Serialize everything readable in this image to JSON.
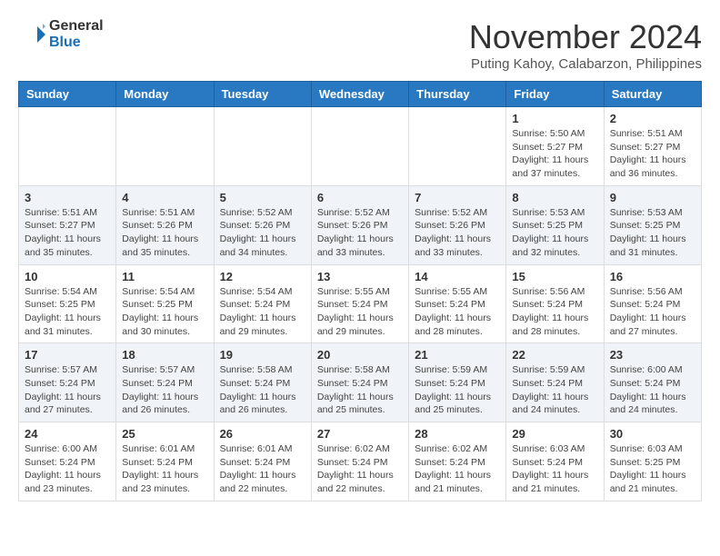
{
  "logo": {
    "general": "General",
    "blue": "Blue"
  },
  "header": {
    "month": "November 2024",
    "location": "Puting Kahoy, Calabarzon, Philippines"
  },
  "weekdays": [
    "Sunday",
    "Monday",
    "Tuesday",
    "Wednesday",
    "Thursday",
    "Friday",
    "Saturday"
  ],
  "weeks": [
    [
      {
        "day": "",
        "info": ""
      },
      {
        "day": "",
        "info": ""
      },
      {
        "day": "",
        "info": ""
      },
      {
        "day": "",
        "info": ""
      },
      {
        "day": "",
        "info": ""
      },
      {
        "day": "1",
        "info": "Sunrise: 5:50 AM\nSunset: 5:27 PM\nDaylight: 11 hours and 37 minutes."
      },
      {
        "day": "2",
        "info": "Sunrise: 5:51 AM\nSunset: 5:27 PM\nDaylight: 11 hours and 36 minutes."
      }
    ],
    [
      {
        "day": "3",
        "info": "Sunrise: 5:51 AM\nSunset: 5:27 PM\nDaylight: 11 hours and 35 minutes."
      },
      {
        "day": "4",
        "info": "Sunrise: 5:51 AM\nSunset: 5:26 PM\nDaylight: 11 hours and 35 minutes."
      },
      {
        "day": "5",
        "info": "Sunrise: 5:52 AM\nSunset: 5:26 PM\nDaylight: 11 hours and 34 minutes."
      },
      {
        "day": "6",
        "info": "Sunrise: 5:52 AM\nSunset: 5:26 PM\nDaylight: 11 hours and 33 minutes."
      },
      {
        "day": "7",
        "info": "Sunrise: 5:52 AM\nSunset: 5:26 PM\nDaylight: 11 hours and 33 minutes."
      },
      {
        "day": "8",
        "info": "Sunrise: 5:53 AM\nSunset: 5:25 PM\nDaylight: 11 hours and 32 minutes."
      },
      {
        "day": "9",
        "info": "Sunrise: 5:53 AM\nSunset: 5:25 PM\nDaylight: 11 hours and 31 minutes."
      }
    ],
    [
      {
        "day": "10",
        "info": "Sunrise: 5:54 AM\nSunset: 5:25 PM\nDaylight: 11 hours and 31 minutes."
      },
      {
        "day": "11",
        "info": "Sunrise: 5:54 AM\nSunset: 5:25 PM\nDaylight: 11 hours and 30 minutes."
      },
      {
        "day": "12",
        "info": "Sunrise: 5:54 AM\nSunset: 5:24 PM\nDaylight: 11 hours and 29 minutes."
      },
      {
        "day": "13",
        "info": "Sunrise: 5:55 AM\nSunset: 5:24 PM\nDaylight: 11 hours and 29 minutes."
      },
      {
        "day": "14",
        "info": "Sunrise: 5:55 AM\nSunset: 5:24 PM\nDaylight: 11 hours and 28 minutes."
      },
      {
        "day": "15",
        "info": "Sunrise: 5:56 AM\nSunset: 5:24 PM\nDaylight: 11 hours and 28 minutes."
      },
      {
        "day": "16",
        "info": "Sunrise: 5:56 AM\nSunset: 5:24 PM\nDaylight: 11 hours and 27 minutes."
      }
    ],
    [
      {
        "day": "17",
        "info": "Sunrise: 5:57 AM\nSunset: 5:24 PM\nDaylight: 11 hours and 27 minutes."
      },
      {
        "day": "18",
        "info": "Sunrise: 5:57 AM\nSunset: 5:24 PM\nDaylight: 11 hours and 26 minutes."
      },
      {
        "day": "19",
        "info": "Sunrise: 5:58 AM\nSunset: 5:24 PM\nDaylight: 11 hours and 26 minutes."
      },
      {
        "day": "20",
        "info": "Sunrise: 5:58 AM\nSunset: 5:24 PM\nDaylight: 11 hours and 25 minutes."
      },
      {
        "day": "21",
        "info": "Sunrise: 5:59 AM\nSunset: 5:24 PM\nDaylight: 11 hours and 25 minutes."
      },
      {
        "day": "22",
        "info": "Sunrise: 5:59 AM\nSunset: 5:24 PM\nDaylight: 11 hours and 24 minutes."
      },
      {
        "day": "23",
        "info": "Sunrise: 6:00 AM\nSunset: 5:24 PM\nDaylight: 11 hours and 24 minutes."
      }
    ],
    [
      {
        "day": "24",
        "info": "Sunrise: 6:00 AM\nSunset: 5:24 PM\nDaylight: 11 hours and 23 minutes."
      },
      {
        "day": "25",
        "info": "Sunrise: 6:01 AM\nSunset: 5:24 PM\nDaylight: 11 hours and 23 minutes."
      },
      {
        "day": "26",
        "info": "Sunrise: 6:01 AM\nSunset: 5:24 PM\nDaylight: 11 hours and 22 minutes."
      },
      {
        "day": "27",
        "info": "Sunrise: 6:02 AM\nSunset: 5:24 PM\nDaylight: 11 hours and 22 minutes."
      },
      {
        "day": "28",
        "info": "Sunrise: 6:02 AM\nSunset: 5:24 PM\nDaylight: 11 hours and 21 minutes."
      },
      {
        "day": "29",
        "info": "Sunrise: 6:03 AM\nSunset: 5:24 PM\nDaylight: 11 hours and 21 minutes."
      },
      {
        "day": "30",
        "info": "Sunrise: 6:03 AM\nSunset: 5:25 PM\nDaylight: 11 hours and 21 minutes."
      }
    ]
  ]
}
